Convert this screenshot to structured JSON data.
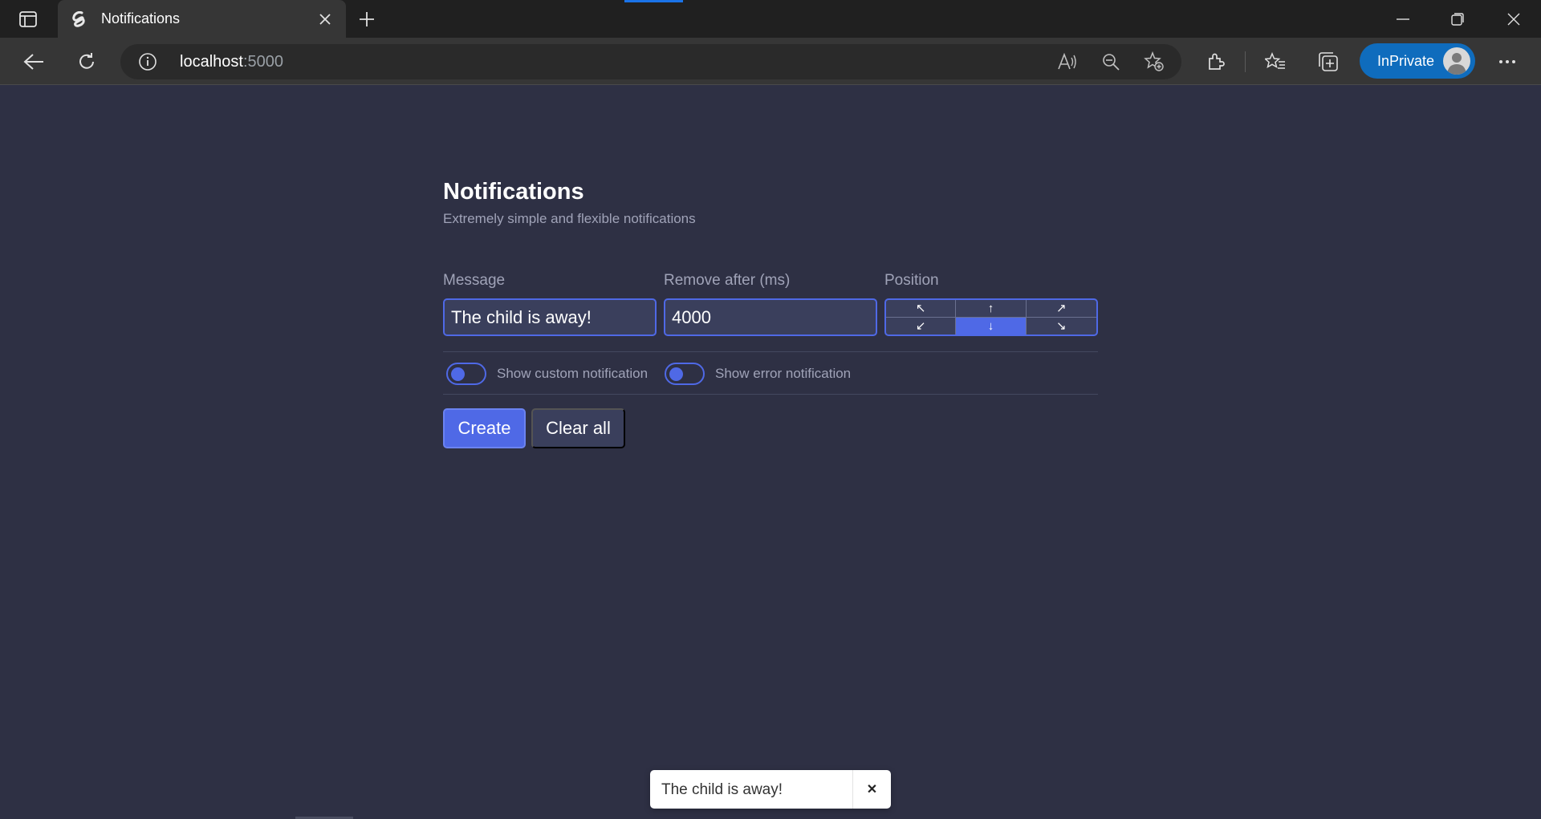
{
  "browser": {
    "tab_title": "Notifications",
    "address_host": "localhost",
    "address_port": ":5000",
    "inprivate_label": "InPrivate",
    "icons": [
      "tab-actions-icon",
      "svelte-favicon-icon",
      "close-icon",
      "plus-icon",
      "minimize-icon",
      "restore-icon",
      "close-window-icon",
      "back-icon",
      "refresh-icon",
      "info-icon",
      "read-aloud-icon",
      "zoom-out-icon",
      "add-favorite-icon",
      "extensions-icon",
      "favorites-icon",
      "collections-icon",
      "more-icon"
    ]
  },
  "app": {
    "title": "Notifications",
    "subtitle": "Extremely simple and flexible notifications",
    "message_label": "Message",
    "message_value": "The child is away!",
    "remove_label": "Remove after (ms)",
    "remove_value": "4000",
    "position_label": "Position",
    "positions": [
      "↖",
      "↑",
      "↗",
      "↙",
      "↓",
      "↘"
    ],
    "active_position": "↓",
    "toggle_custom_label": "Show custom notification",
    "toggle_error_label": "Show error notification",
    "create_label": "Create",
    "clear_label": "Clear all"
  },
  "toast": {
    "message": "The child is away!",
    "close_symbol": "✕"
  },
  "colors": {
    "page_bg": "#2e3044",
    "accent": "#4f69e6",
    "input_bg": "#3a3f5c"
  }
}
